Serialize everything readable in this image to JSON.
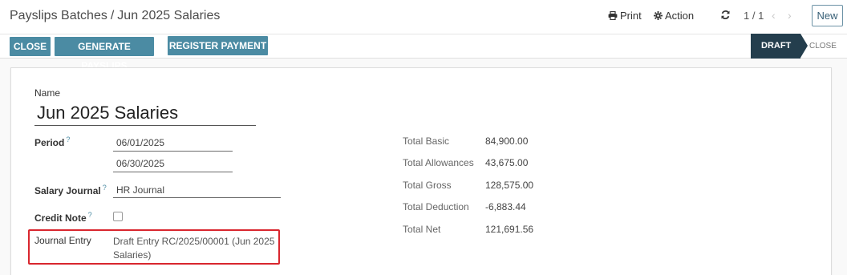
{
  "breadcrumb": {
    "parent": "Payslips Batches",
    "separator": "/",
    "current": "Jun 2025 Salaries"
  },
  "toolbar": {
    "print_label": "Print",
    "action_label": "Action"
  },
  "pager": {
    "value": "1 / 1",
    "prev": "‹",
    "next": "›"
  },
  "new_button": "New",
  "statusbar": {
    "buttons": {
      "close": "CLOSE",
      "generate": "GENERATE PAYSLIPS",
      "register": "REGISTER PAYMENT"
    },
    "stages": {
      "draft": "DRAFT",
      "close": "CLOSE"
    }
  },
  "form": {
    "name_label": "Name",
    "name_value": "Jun 2025 Salaries",
    "period_label": "Period",
    "period_start": "06/01/2025",
    "period_end": "06/30/2025",
    "salary_journal_label": "Salary Journal",
    "salary_journal_value": "HR Journal",
    "credit_note_label": "Credit Note",
    "journal_entry_label": "Journal Entry",
    "journal_entry_value": "Draft Entry RC/2025/00001 (Jun 2025 Salaries)",
    "help_marker": "?"
  },
  "totals": [
    {
      "label": "Total Basic",
      "value": "84,900.00"
    },
    {
      "label": "Total Allowances",
      "value": "43,675.00"
    },
    {
      "label": "Total Gross",
      "value": "128,575.00"
    },
    {
      "label": "Total Deduction",
      "value": "-6,883.44"
    },
    {
      "label": "Total Net",
      "value": "121,691.56"
    }
  ],
  "colors": {
    "primary": "#4b8ba3",
    "stage_active": "#243e4d",
    "highlight": "#d9262e"
  },
  "icons": {
    "print": "print-icon",
    "action": "gear-icon",
    "refresh": "refresh-icon"
  }
}
